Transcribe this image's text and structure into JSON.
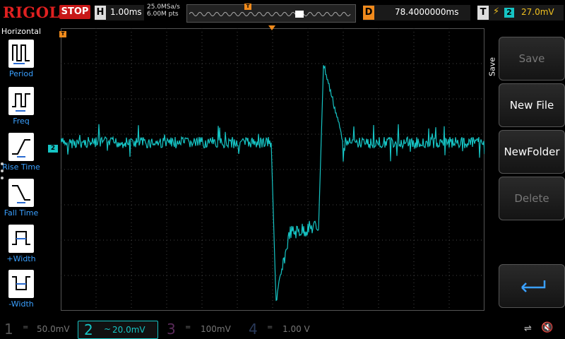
{
  "header": {
    "brand": "RIGOL",
    "run_status": "STOP",
    "horizontal_badge": "H",
    "timebase": "1.00ms",
    "sample_rate": "25.0MSa/s",
    "memory_depth": "6.00M pts",
    "memory_trigger_marker": "T",
    "delay_badge": "D",
    "delay": "78.4000000ms",
    "trigger_badge": "T",
    "trigger_edge_icon": "rising-edge-icon",
    "trigger_source": "2",
    "trigger_level": "27.0mV"
  },
  "left_menu": {
    "title": "Horizontal",
    "items": [
      {
        "label": "Period",
        "icon": "period-icon"
      },
      {
        "label": "Freq",
        "icon": "frequency-icon"
      },
      {
        "label": "Rise Time",
        "icon": "rise-time-icon"
      },
      {
        "label": "Fall Time",
        "icon": "fall-time-icon"
      },
      {
        "label": "+Width",
        "icon": "positive-width-icon"
      },
      {
        "label": "-Width",
        "icon": "negative-width-icon"
      }
    ]
  },
  "right_menu": {
    "side_label": "Save",
    "buttons": [
      {
        "label": "Save",
        "enabled": false
      },
      {
        "label": "New File",
        "enabled": true
      },
      {
        "label": "NewFolder",
        "enabled": true
      },
      {
        "label": "Delete",
        "enabled": false
      }
    ],
    "return_icon": "return-arrow-icon"
  },
  "waveform": {
    "channel_marker": "2",
    "trigger_position_marker": "T",
    "color": "#16c4c4"
  },
  "channels": [
    {
      "number": "1",
      "scale": "50.0mV",
      "coupling": "=",
      "active": false
    },
    {
      "number": "2",
      "scale": "20.0mV",
      "coupling": "~",
      "active": true
    },
    {
      "number": "3",
      "scale": "100mV",
      "coupling": "=",
      "active": false
    },
    {
      "number": "4",
      "scale": "1.00 V",
      "coupling": "=",
      "active": false
    }
  ],
  "status_icons": [
    "usb-icon",
    "speaker-muted-icon"
  ],
  "colors": {
    "channel2": "#16c4c4",
    "stop": "#c81818",
    "trigger": "#f08a1c",
    "brand": "#e02020",
    "menu_label": "#3aa0ff"
  }
}
